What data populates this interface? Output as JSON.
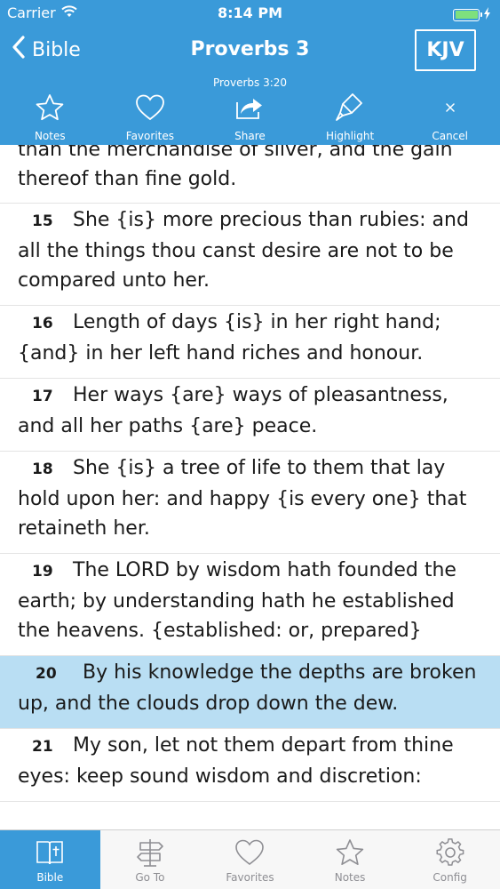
{
  "status": {
    "carrier": "Carrier",
    "time": "8:14 PM"
  },
  "nav": {
    "back_label": "Bible",
    "title": "Proverbs 3",
    "version": "KJV",
    "verse_ref": "Proverbs 3:20"
  },
  "actions": [
    {
      "label": "Notes",
      "icon": "star-icon"
    },
    {
      "label": "Favorites",
      "icon": "heart-icon"
    },
    {
      "label": "Share",
      "icon": "share-icon"
    },
    {
      "label": "Highlight",
      "icon": "highlighter-icon"
    },
    {
      "label": "Cancel",
      "icon": "close-icon"
    }
  ],
  "verses": [
    {
      "num": "",
      "text": "than the merchandise of silver, and the gain thereof than fine gold."
    },
    {
      "num": "15",
      "text": "She {is} more precious than rubies: and all the things thou canst desire are not to be compared unto her."
    },
    {
      "num": "16",
      "text": "Length of days {is} in her right hand; {and} in her left hand riches and honour."
    },
    {
      "num": "17",
      "text": "Her ways {are} ways of pleasantness, and all her paths {are} peace."
    },
    {
      "num": "18",
      "text": "She {is} a tree of life to them that lay hold upon her: and happy {is every one} that retaineth her."
    },
    {
      "num": "19",
      "text": "The LORD by wisdom hath founded the earth; by understanding hath he established the heavens. {established: or, prepared}"
    },
    {
      "num": "20",
      "text": "By his knowledge the depths are broken up, and the clouds drop down the dew."
    },
    {
      "num": "21",
      "text": "My son, let not them depart from thine eyes: keep sound wisdom and discretion:"
    }
  ],
  "highlighted_verse": "20",
  "tabs": [
    {
      "label": "Bible",
      "icon": "book-icon",
      "active": true
    },
    {
      "label": "Go To",
      "icon": "signpost-icon",
      "active": false
    },
    {
      "label": "Favorites",
      "icon": "heart-icon",
      "active": false
    },
    {
      "label": "Notes",
      "icon": "star-icon",
      "active": false
    },
    {
      "label": "Config",
      "icon": "gear-icon",
      "active": false
    }
  ],
  "colors": {
    "header": "#3a9ad9",
    "highlight": "#b9def3",
    "tab_inactive": "#8e8e93"
  }
}
